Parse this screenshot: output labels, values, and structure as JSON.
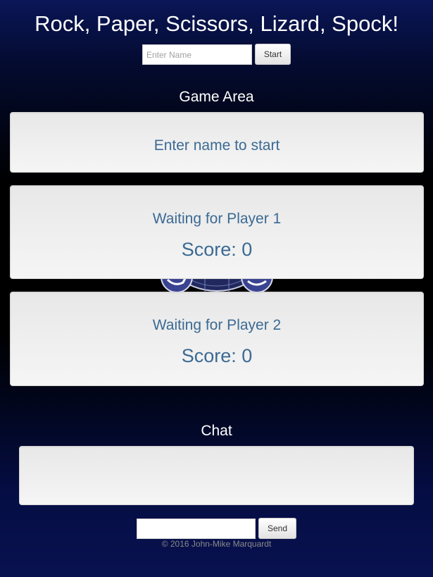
{
  "header": {
    "title": "Rock, Paper, Scissors, Lizard, Spock!",
    "name_placeholder": "Enter Name",
    "start_label": "Start"
  },
  "game": {
    "heading": "Game Area",
    "status": "Enter name to start",
    "player1": {
      "label": "Waiting for Player 1",
      "score": "Score: 0"
    },
    "player2": {
      "label": "Waiting for Player 2",
      "score": "Score: 0"
    }
  },
  "chat": {
    "heading": "Chat",
    "send_label": "Send"
  },
  "footer": {
    "copyright": "© 2016 John-Mike Marquardt"
  },
  "colors": {
    "well_text": "#3b6a94",
    "background_top": "#0a1657",
    "background_mid": "#000000"
  }
}
